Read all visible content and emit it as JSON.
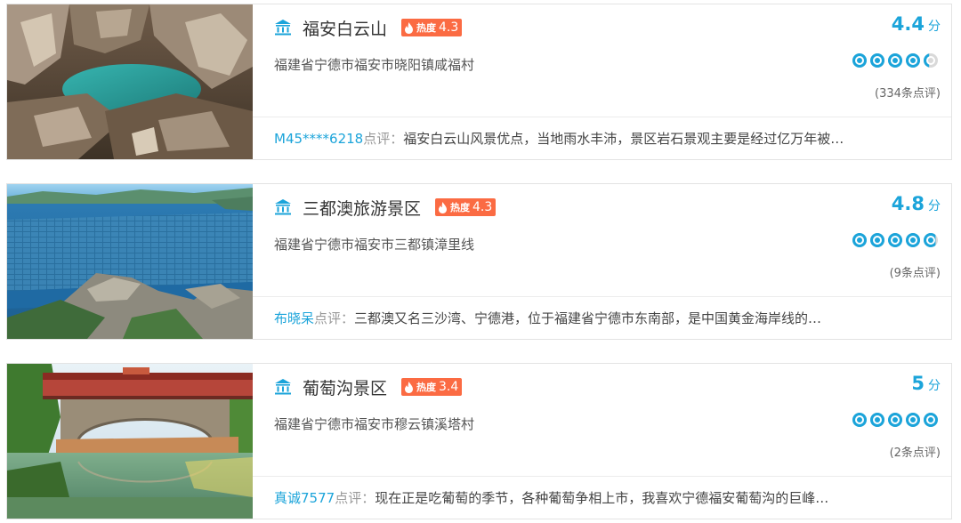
{
  "accent_color": "#1ba4da",
  "hot_color": "#fb6b43",
  "hot_label": "热度",
  "score_unit": "分",
  "review_label": "点评：",
  "listings": [
    {
      "title": "福安白云山",
      "hot": "4.3",
      "address": "福建省宁德市福安市晓阳镇咸福村",
      "score": "4.4",
      "rating": 4.4,
      "reviews": "(334条点评)",
      "review_user": "M45****6218",
      "review_text": "福安白云山风景优点，当地雨水丰沛，景区岩石景观主要是经过亿万年被…",
      "icon": "landmark-icon",
      "image": "rock-pool-photo"
    },
    {
      "title": "三都澳旅游景区",
      "hot": "4.3",
      "address": "福建省宁德市福安市三都镇漳里线",
      "score": "4.8",
      "rating": 4.8,
      "reviews": "(9条点评)",
      "review_user": "布晓呆",
      "review_text": "三都澳又名三沙湾、宁德港，位于福建省宁德市东南部，是中国黄金海岸线的…",
      "icon": "landmark-icon",
      "image": "bay-aquaculture-photo"
    },
    {
      "title": "葡萄沟景区",
      "hot": "3.4",
      "address": "福建省宁德市福安市穆云镇溪塔村",
      "score": "5",
      "rating": 5,
      "reviews": "(2条点评)",
      "review_user": "真诚7577",
      "review_text": "现在正是吃葡萄的季节，各种葡萄争相上市，我喜欢宁德福安葡萄沟的巨峰…",
      "icon": "landmark-icon",
      "image": "covered-bridge-photo"
    }
  ]
}
